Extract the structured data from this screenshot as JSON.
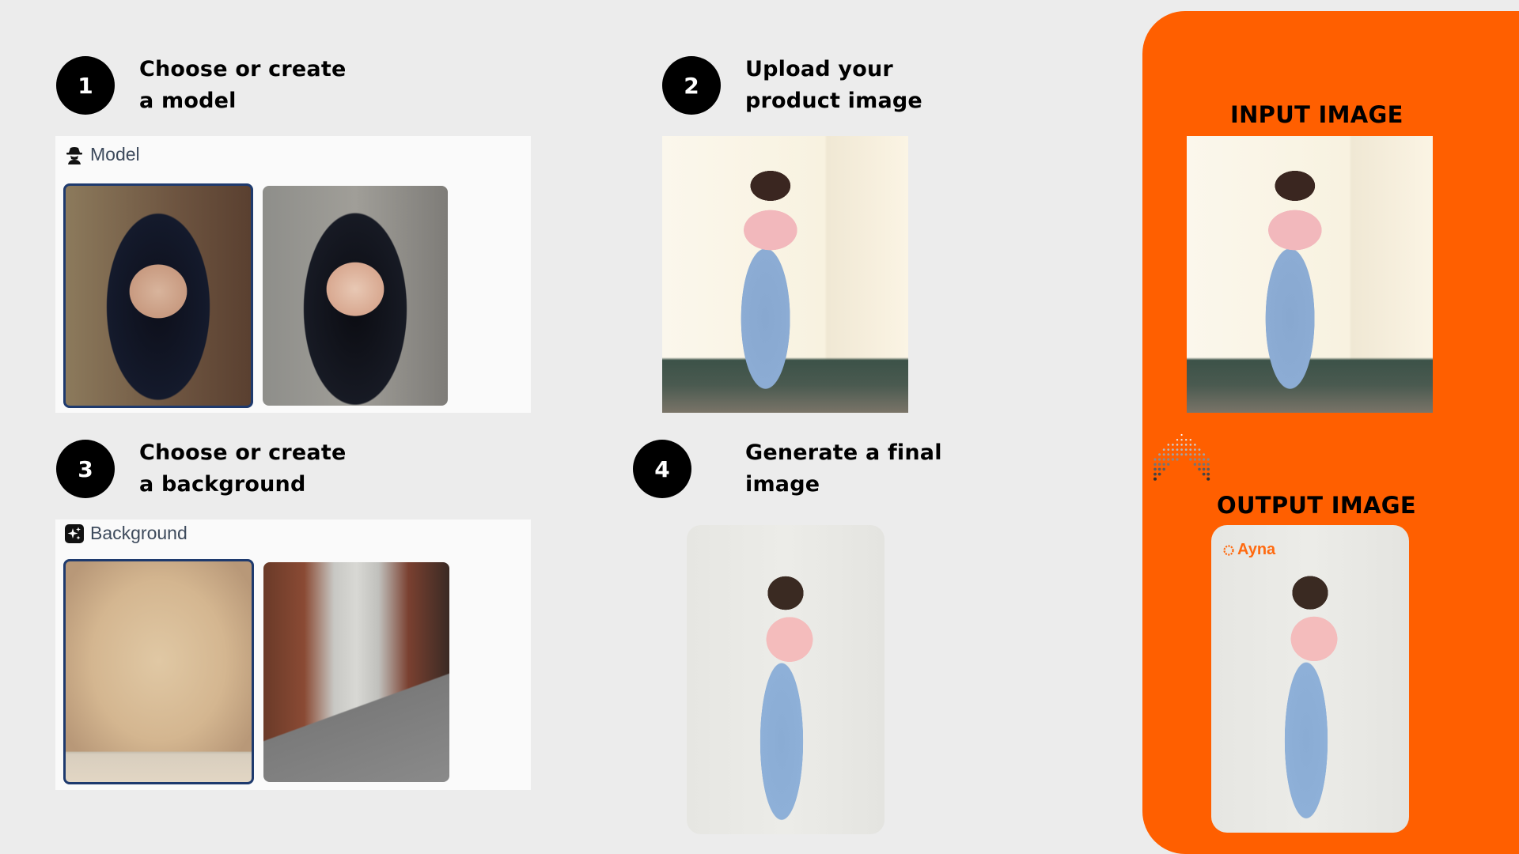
{
  "steps": [
    {
      "number": "1",
      "title_line1": "Choose or create",
      "title_line2": "a model"
    },
    {
      "number": "2",
      "title_line1": "Upload your",
      "title_line2": "product image"
    },
    {
      "number": "3",
      "title_line1": "Choose or create",
      "title_line2": "a background"
    },
    {
      "number": "4",
      "title_line1": "Generate a final",
      "title_line2": "image"
    }
  ],
  "model_picker": {
    "label": "Model",
    "icon": "spy-icon",
    "options": [
      {
        "name": "model-option-1",
        "selected": true
      },
      {
        "name": "model-option-2",
        "selected": false
      }
    ]
  },
  "background_picker": {
    "label": "Background",
    "icon": "sparkles-icon",
    "options": [
      {
        "name": "background-studio",
        "selected": true
      },
      {
        "name": "background-street",
        "selected": false
      }
    ]
  },
  "result_panel": {
    "input_label": "INPUT IMAGE",
    "output_label": "OUTPUT IMAGE",
    "brand": "Ayna",
    "accent_color": "#FF5F00"
  },
  "colors": {
    "page_background": "#ECECEC",
    "selected_border": "#1E3A6E",
    "step_circle": "#000000"
  }
}
